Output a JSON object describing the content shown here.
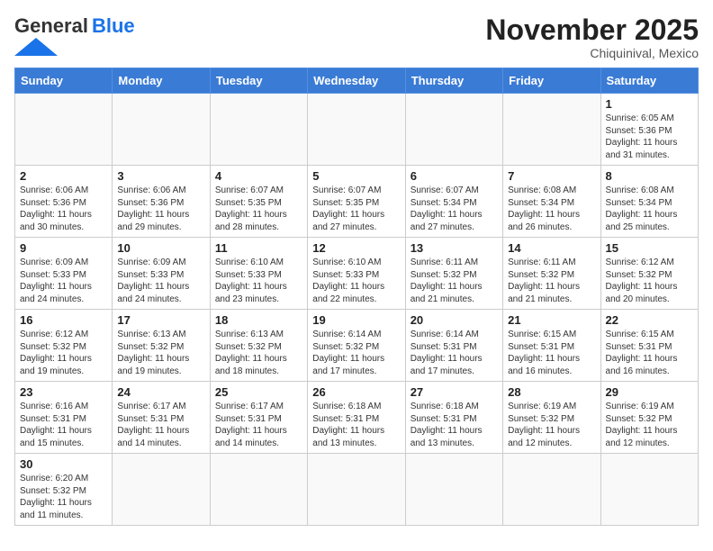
{
  "header": {
    "logo_text_general": "General",
    "logo_text_blue": "Blue",
    "month_title": "November 2025",
    "location": "Chiquinival, Mexico"
  },
  "days_of_week": [
    "Sunday",
    "Monday",
    "Tuesday",
    "Wednesday",
    "Thursday",
    "Friday",
    "Saturday"
  ],
  "weeks": [
    [
      {
        "day": "",
        "info": ""
      },
      {
        "day": "",
        "info": ""
      },
      {
        "day": "",
        "info": ""
      },
      {
        "day": "",
        "info": ""
      },
      {
        "day": "",
        "info": ""
      },
      {
        "day": "",
        "info": ""
      },
      {
        "day": "1",
        "info": "Sunrise: 6:05 AM\nSunset: 5:36 PM\nDaylight: 11 hours and 31 minutes."
      }
    ],
    [
      {
        "day": "2",
        "info": "Sunrise: 6:06 AM\nSunset: 5:36 PM\nDaylight: 11 hours and 30 minutes."
      },
      {
        "day": "3",
        "info": "Sunrise: 6:06 AM\nSunset: 5:36 PM\nDaylight: 11 hours and 29 minutes."
      },
      {
        "day": "4",
        "info": "Sunrise: 6:07 AM\nSunset: 5:35 PM\nDaylight: 11 hours and 28 minutes."
      },
      {
        "day": "5",
        "info": "Sunrise: 6:07 AM\nSunset: 5:35 PM\nDaylight: 11 hours and 27 minutes."
      },
      {
        "day": "6",
        "info": "Sunrise: 6:07 AM\nSunset: 5:34 PM\nDaylight: 11 hours and 27 minutes."
      },
      {
        "day": "7",
        "info": "Sunrise: 6:08 AM\nSunset: 5:34 PM\nDaylight: 11 hours and 26 minutes."
      },
      {
        "day": "8",
        "info": "Sunrise: 6:08 AM\nSunset: 5:34 PM\nDaylight: 11 hours and 25 minutes."
      }
    ],
    [
      {
        "day": "9",
        "info": "Sunrise: 6:09 AM\nSunset: 5:33 PM\nDaylight: 11 hours and 24 minutes."
      },
      {
        "day": "10",
        "info": "Sunrise: 6:09 AM\nSunset: 5:33 PM\nDaylight: 11 hours and 24 minutes."
      },
      {
        "day": "11",
        "info": "Sunrise: 6:10 AM\nSunset: 5:33 PM\nDaylight: 11 hours and 23 minutes."
      },
      {
        "day": "12",
        "info": "Sunrise: 6:10 AM\nSunset: 5:33 PM\nDaylight: 11 hours and 22 minutes."
      },
      {
        "day": "13",
        "info": "Sunrise: 6:11 AM\nSunset: 5:32 PM\nDaylight: 11 hours and 21 minutes."
      },
      {
        "day": "14",
        "info": "Sunrise: 6:11 AM\nSunset: 5:32 PM\nDaylight: 11 hours and 21 minutes."
      },
      {
        "day": "15",
        "info": "Sunrise: 6:12 AM\nSunset: 5:32 PM\nDaylight: 11 hours and 20 minutes."
      }
    ],
    [
      {
        "day": "16",
        "info": "Sunrise: 6:12 AM\nSunset: 5:32 PM\nDaylight: 11 hours and 19 minutes."
      },
      {
        "day": "17",
        "info": "Sunrise: 6:13 AM\nSunset: 5:32 PM\nDaylight: 11 hours and 19 minutes."
      },
      {
        "day": "18",
        "info": "Sunrise: 6:13 AM\nSunset: 5:32 PM\nDaylight: 11 hours and 18 minutes."
      },
      {
        "day": "19",
        "info": "Sunrise: 6:14 AM\nSunset: 5:32 PM\nDaylight: 11 hours and 17 minutes."
      },
      {
        "day": "20",
        "info": "Sunrise: 6:14 AM\nSunset: 5:31 PM\nDaylight: 11 hours and 17 minutes."
      },
      {
        "day": "21",
        "info": "Sunrise: 6:15 AM\nSunset: 5:31 PM\nDaylight: 11 hours and 16 minutes."
      },
      {
        "day": "22",
        "info": "Sunrise: 6:15 AM\nSunset: 5:31 PM\nDaylight: 11 hours and 16 minutes."
      }
    ],
    [
      {
        "day": "23",
        "info": "Sunrise: 6:16 AM\nSunset: 5:31 PM\nDaylight: 11 hours and 15 minutes."
      },
      {
        "day": "24",
        "info": "Sunrise: 6:17 AM\nSunset: 5:31 PM\nDaylight: 11 hours and 14 minutes."
      },
      {
        "day": "25",
        "info": "Sunrise: 6:17 AM\nSunset: 5:31 PM\nDaylight: 11 hours and 14 minutes."
      },
      {
        "day": "26",
        "info": "Sunrise: 6:18 AM\nSunset: 5:31 PM\nDaylight: 11 hours and 13 minutes."
      },
      {
        "day": "27",
        "info": "Sunrise: 6:18 AM\nSunset: 5:31 PM\nDaylight: 11 hours and 13 minutes."
      },
      {
        "day": "28",
        "info": "Sunrise: 6:19 AM\nSunset: 5:32 PM\nDaylight: 11 hours and 12 minutes."
      },
      {
        "day": "29",
        "info": "Sunrise: 6:19 AM\nSunset: 5:32 PM\nDaylight: 11 hours and 12 minutes."
      }
    ],
    [
      {
        "day": "30",
        "info": "Sunrise: 6:20 AM\nSunset: 5:32 PM\nDaylight: 11 hours and 11 minutes."
      },
      {
        "day": "",
        "info": ""
      },
      {
        "day": "",
        "info": ""
      },
      {
        "day": "",
        "info": ""
      },
      {
        "day": "",
        "info": ""
      },
      {
        "day": "",
        "info": ""
      },
      {
        "day": "",
        "info": ""
      }
    ]
  ]
}
